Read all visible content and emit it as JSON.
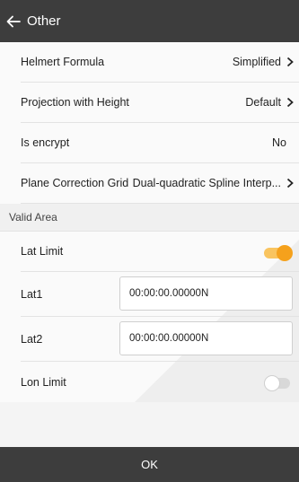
{
  "header": {
    "title": "Other"
  },
  "settings": [
    {
      "label": "Helmert Formula",
      "value": "Simplified",
      "chevron": true
    },
    {
      "label": "Projection with Height",
      "value": "Default",
      "chevron": true
    },
    {
      "label": "Is encrypt",
      "value": "No",
      "chevron": false
    },
    {
      "label": "Plane Correction Grid",
      "value": "Dual-quadratic Spline Interp...",
      "chevron": true
    }
  ],
  "valid_area": {
    "section_title": "Valid Area",
    "lat_limit": {
      "label": "Lat Limit",
      "enabled": true
    },
    "lat1": {
      "label": "Lat1",
      "value": "00:00:00.00000N"
    },
    "lat2": {
      "label": "Lat2",
      "value": "00:00:00.00000N"
    },
    "lon_limit": {
      "label": "Lon Limit",
      "enabled": false
    }
  },
  "footer": {
    "ok_label": "OK"
  },
  "colors": {
    "bar": "#3d3d3d",
    "accent": "#f5a11c"
  }
}
